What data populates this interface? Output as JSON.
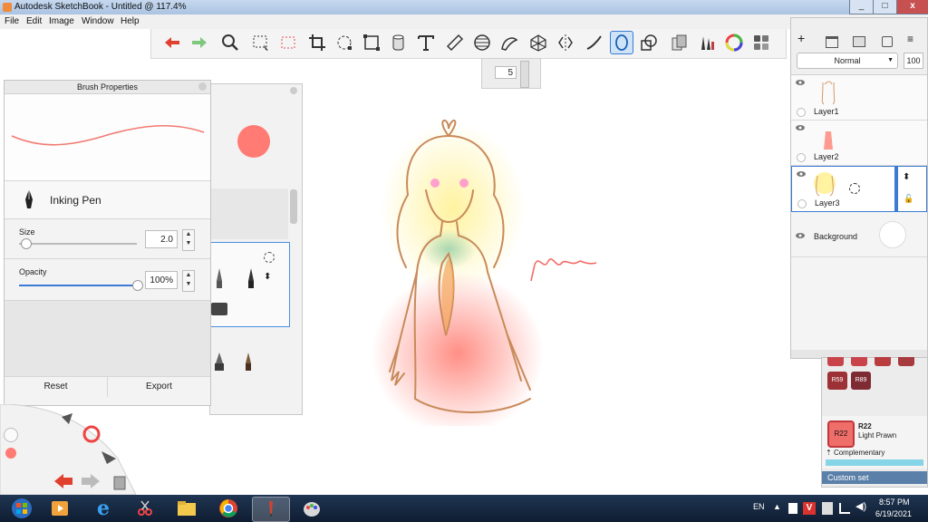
{
  "window": {
    "title": "Autodesk SketchBook - Untitled @ 117.4%",
    "min": "_",
    "max": "□",
    "close": "x"
  },
  "menu": [
    "File",
    "Edit",
    "Image",
    "Window",
    "Help"
  ],
  "toolbar": {
    "tools": [
      "undo-icon",
      "redo-icon",
      "zoom-icon",
      "select-rect-icon",
      "select-lasso-icon",
      "crop-icon",
      "transform-icon",
      "distort-icon",
      "fill-icon",
      "text-icon",
      "ruler-icon",
      "ellipse-guide-icon",
      "french-curve-icon",
      "perspective-icon",
      "symmetry-icon",
      "stroke-icon",
      "predictive-stroke-icon",
      "shape-icon",
      "copy-icon",
      "brush-library-icon",
      "color-wheel-icon",
      "copic-icon"
    ],
    "active_index": 16,
    "brush_size_value": "5"
  },
  "brush_properties": {
    "title": "Brush Properties",
    "brush_name": "Inking Pen",
    "size_label": "Size",
    "size_value": "2.0",
    "size_fraction": 0.05,
    "opacity_label": "Opacity",
    "opacity_value": "100%",
    "opacity_fraction": 1.0,
    "reset_label": "Reset",
    "export_label": "Export"
  },
  "colors": {
    "current_color": "#ff7b73",
    "accent": "#3a7bd5",
    "copic_current": "#f06e6a"
  },
  "layers": {
    "blend_mode": "Normal",
    "opacity": "100",
    "items": [
      {
        "name": "Layer1"
      },
      {
        "name": "Layer2"
      },
      {
        "name": "Layer3",
        "selected": true
      },
      {
        "name": "Background"
      }
    ]
  },
  "copic": {
    "code": "R22",
    "name": "Light Prawn",
    "complementary": "Complementary",
    "custom_set": "Custom set",
    "swatches": [
      "R59",
      "R89"
    ]
  },
  "taskbar": {
    "lang": "EN",
    "time": "8:57 PM",
    "date": "6/19/2021"
  }
}
